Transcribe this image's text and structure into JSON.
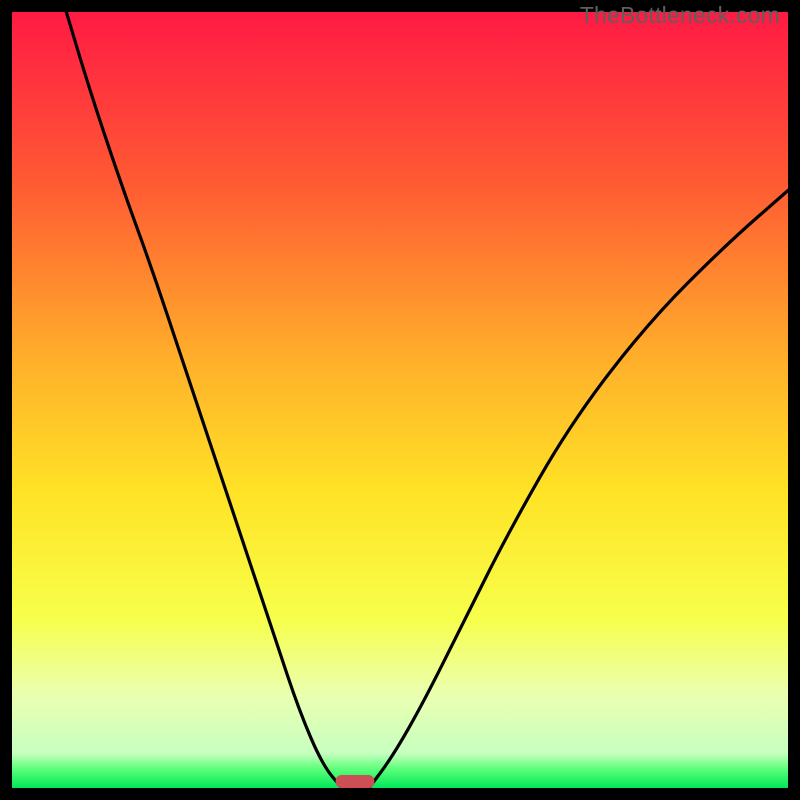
{
  "watermark": "TheBottleneck.com",
  "chart_data": {
    "type": "line",
    "title": "",
    "xlabel": "",
    "ylabel": "",
    "xlim": [
      0,
      100
    ],
    "ylim": [
      0,
      100
    ],
    "gradient_stops": [
      {
        "offset": 0.0,
        "color": "#ff1a44"
      },
      {
        "offset": 0.22,
        "color": "#ff5a33"
      },
      {
        "offset": 0.45,
        "color": "#ffb02a"
      },
      {
        "offset": 0.62,
        "color": "#ffe326"
      },
      {
        "offset": 0.78,
        "color": "#f7ff4a"
      },
      {
        "offset": 0.88,
        "color": "#eaffb0"
      },
      {
        "offset": 0.955,
        "color": "#c8ffc0"
      },
      {
        "offset": 0.975,
        "color": "#5fff7a"
      },
      {
        "offset": 1.0,
        "color": "#00e858"
      }
    ],
    "series": [
      {
        "name": "left-curve",
        "x": [
          7,
          10,
          14,
          18,
          22,
          26,
          30,
          34,
          37,
          40,
          42.5
        ],
        "y": [
          100,
          90,
          78,
          67,
          55,
          43,
          31,
          19,
          10,
          3,
          0
        ]
      },
      {
        "name": "right-curve",
        "x": [
          46,
          49,
          53,
          58,
          64,
          72,
          82,
          92,
          100
        ],
        "y": [
          0,
          4,
          11,
          21,
          33,
          47,
          60,
          70,
          77
        ]
      }
    ],
    "marker": {
      "name": "bottleneck-marker",
      "x_center": 44.2,
      "width": 5.0,
      "color": "#cc4f55"
    }
  }
}
